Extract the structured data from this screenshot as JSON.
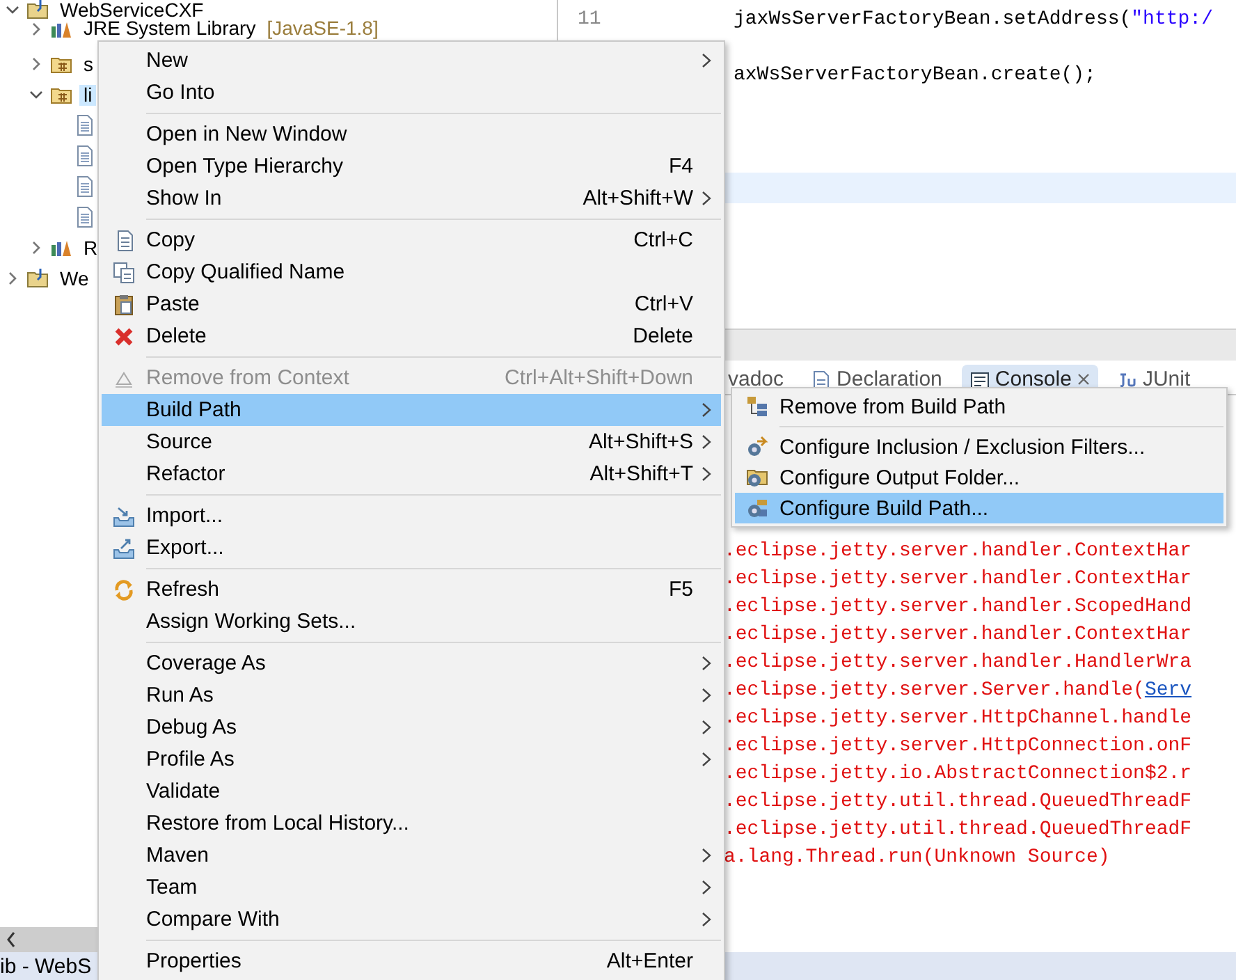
{
  "project_explorer": {
    "items": [
      {
        "kind": "project",
        "label": "WebServiceCXF",
        "expanded": true,
        "selected": false,
        "children": [
          {
            "kind": "library",
            "label": "JRE System Library",
            "decoration": "[JavaSE-1.8]",
            "expanded": false,
            "selected": false
          },
          {
            "kind": "package",
            "label": "s",
            "expanded": false,
            "selected": false
          },
          {
            "kind": "package",
            "label": "li",
            "expanded": true,
            "selected": true,
            "children": [
              {
                "kind": "file",
                "selected": false
              },
              {
                "kind": "file",
                "selected": false
              },
              {
                "kind": "file",
                "selected": false
              },
              {
                "kind": "file",
                "selected": false
              }
            ]
          },
          {
            "kind": "library",
            "label": "R",
            "expanded": false,
            "selected": false
          }
        ]
      },
      {
        "kind": "project",
        "label": "We",
        "expanded": false,
        "selected": false
      }
    ]
  },
  "editor": {
    "lines": [
      {
        "kind": "code",
        "number": "11",
        "code": "jaxWsServerFactoryBean.setAddress(",
        "string": "\"http:/"
      },
      {
        "kind": "blank"
      },
      {
        "kind": "code",
        "code": "axWsServerFactoryBean.create();"
      }
    ]
  },
  "console": {
    "tabs": [
      {
        "kind": "javadoc",
        "label": "vadoc",
        "selected": false
      },
      {
        "kind": "declaration",
        "label": "Declaration",
        "selected": false
      },
      {
        "kind": "console",
        "label": "Console",
        "selected": true,
        "closable": true
      },
      {
        "kind": "junit",
        "label": "JUnit",
        "selected": false
      }
    ],
    "lines": [
      {
        "text": ".eclipse.jetty.server.handler.ContextHar"
      },
      {
        "text": ".eclipse.jetty.server.handler.ContextHar"
      },
      {
        "text": ".eclipse.jetty.server.handler.ScopedHand"
      },
      {
        "text": ".eclipse.jetty.server.handler.ContextHar"
      },
      {
        "text": ".eclipse.jetty.server.handler.HandlerWra"
      },
      {
        "text": ".eclipse.jetty.server.Server.handle(",
        "link": "Serv"
      },
      {
        "text": ".eclipse.jetty.server.HttpChannel.handle"
      },
      {
        "text": ".eclipse.jetty.server.HttpConnection.onF"
      },
      {
        "text": ".eclipse.jetty.io.AbstractConnection$2.r"
      },
      {
        "text": ".eclipse.jetty.util.thread.QueuedThreadF"
      },
      {
        "text": ".eclipse.jetty.util.thread.QueuedThreadF"
      },
      {
        "text": "a.lang.Thread.run(Unknown Source)"
      }
    ]
  },
  "status_bar": {
    "text": "ib - WebS"
  },
  "context_menu": {
    "sections": [
      [
        {
          "label": "New",
          "submenu": true,
          "disabled": false,
          "selected": false
        },
        {
          "label": "Go Into",
          "submenu": false,
          "disabled": false,
          "selected": false
        }
      ],
      [
        {
          "label": "Open in New Window",
          "submenu": false,
          "disabled": false,
          "selected": false
        },
        {
          "label": "Open Type Hierarchy",
          "shortcut": "F4",
          "submenu": false,
          "disabled": false,
          "selected": false
        },
        {
          "label": "Show In",
          "shortcut": "Alt+Shift+W",
          "submenu": true,
          "disabled": false,
          "selected": false
        }
      ],
      [
        {
          "label": "Copy",
          "shortcut": "Ctrl+C",
          "kind": "copy",
          "submenu": false,
          "disabled": false,
          "selected": false
        },
        {
          "label": "Copy Qualified Name",
          "kind": "copy-name",
          "submenu": false,
          "disabled": false,
          "selected": false
        },
        {
          "label": "Paste",
          "shortcut": "Ctrl+V",
          "kind": "paste",
          "submenu": false,
          "disabled": false,
          "selected": false
        },
        {
          "label": "Delete",
          "shortcut": "Delete",
          "kind": "delete",
          "submenu": false,
          "disabled": false,
          "selected": false
        }
      ],
      [
        {
          "label": "Remove from Context",
          "shortcut": "Ctrl+Alt+Shift+Down",
          "kind": "remove-context",
          "submenu": false,
          "disabled": true,
          "selected": false
        },
        {
          "label": "Build Path",
          "submenu": true,
          "disabled": false,
          "selected": true
        },
        {
          "label": "Source",
          "shortcut": "Alt+Shift+S",
          "submenu": true,
          "disabled": false,
          "selected": false
        },
        {
          "label": "Refactor",
          "shortcut": "Alt+Shift+T",
          "submenu": true,
          "disabled": false,
          "selected": false
        }
      ],
      [
        {
          "label": "Import...",
          "kind": "import",
          "submenu": false,
          "disabled": false,
          "selected": false
        },
        {
          "label": "Export...",
          "kind": "export",
          "submenu": false,
          "disabled": false,
          "selected": false
        }
      ],
      [
        {
          "label": "Refresh",
          "shortcut": "F5",
          "kind": "refresh",
          "submenu": false,
          "disabled": false,
          "selected": false
        },
        {
          "label": "Assign Working Sets...",
          "submenu": false,
          "disabled": false,
          "selected": false
        }
      ],
      [
        {
          "label": "Coverage As",
          "submenu": true,
          "disabled": false,
          "selected": false
        },
        {
          "label": "Run As",
          "submenu": true,
          "disabled": false,
          "selected": false
        },
        {
          "label": "Debug As",
          "submenu": true,
          "disabled": false,
          "selected": false
        },
        {
          "label": "Profile As",
          "submenu": true,
          "disabled": false,
          "selected": false
        },
        {
          "label": "Validate",
          "submenu": false,
          "disabled": false,
          "selected": false
        },
        {
          "label": "Restore from Local History...",
          "submenu": false,
          "disabled": false,
          "selected": false
        },
        {
          "label": "Maven",
          "submenu": true,
          "disabled": false,
          "selected": false
        },
        {
          "label": "Team",
          "submenu": true,
          "disabled": false,
          "selected": false
        },
        {
          "label": "Compare With",
          "submenu": true,
          "disabled": false,
          "selected": false
        }
      ],
      [
        {
          "label": "Properties",
          "shortcut": "Alt+Enter",
          "submenu": false,
          "disabled": false,
          "selected": false
        }
      ]
    ]
  },
  "build_path_submenu": {
    "sections": [
      [
        {
          "label": "Remove from Build Path",
          "kind": "build-remove",
          "selected": false
        }
      ],
      [
        {
          "label": "Configure Inclusion / Exclusion Filters...",
          "kind": "filters",
          "selected": false
        },
        {
          "label": "Configure Output Folder...",
          "kind": "output-folder",
          "selected": false
        },
        {
          "label": "Configure Build Path...",
          "kind": "build-config",
          "selected": true
        }
      ]
    ]
  }
}
